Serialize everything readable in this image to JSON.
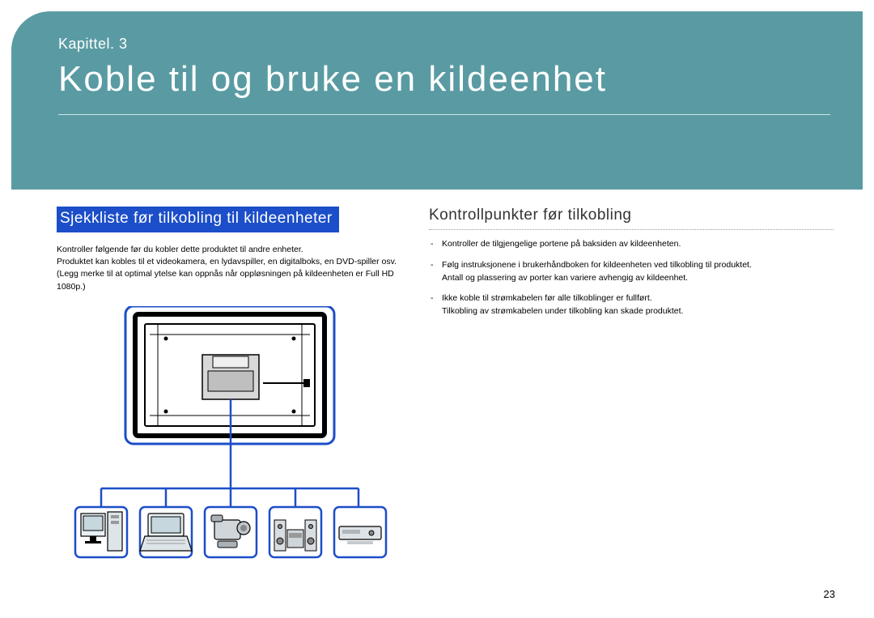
{
  "chapter": {
    "label": "Kapittel. 3",
    "title": "Koble til og bruke en kildeenhet"
  },
  "left": {
    "heading": "Sjekkliste før tilkobling til kildeenheter",
    "body": "Kontroller følgende før du kobler dette produktet til andre enheter.\nProduktet kan kobles til et videokamera, en lydavspiller, en digitalboks, en DVD-spiller osv.\n(Legg merke til at optimal ytelse kan oppnås når oppløsningen på kildeenheten er Full HD 1080p.)"
  },
  "right": {
    "heading": "Kontrollpunkter før tilkobling",
    "bullets": [
      "Kontroller de tilgjengelige portene på baksiden av kildeenheten.",
      "Følg instruksjonene i brukerhåndboken for kildeenheten ved tilkobling til produktet.\nAntall og plassering av porter kan variere avhengig av kildeenhet.",
      "Ikke koble til strømkabelen før alle tilkoblinger er fullført.\nTilkobling av strømkabelen under tilkobling kan skade produktet."
    ]
  },
  "page_number": "23",
  "diagram": {
    "devices": [
      "desktop-pc",
      "laptop",
      "camcorder",
      "audio-system",
      "dvd-player"
    ]
  }
}
